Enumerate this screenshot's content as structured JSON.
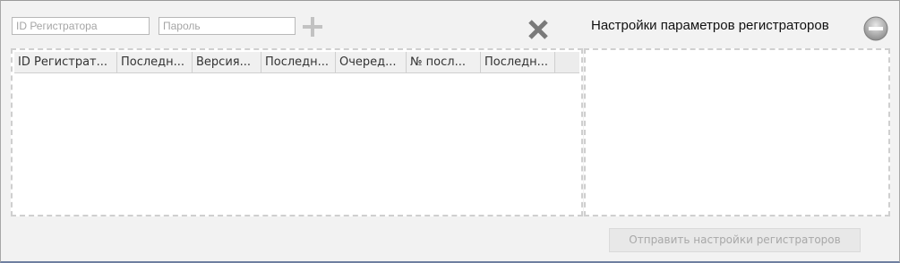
{
  "filters": {
    "id_placeholder": "ID Регистратора",
    "password_placeholder": "Пароль"
  },
  "icons": {
    "add": "plus-icon",
    "remove": "close-icon",
    "collapse": "minus-circle-icon"
  },
  "settings": {
    "title": "Настройки параметров регистраторов"
  },
  "table": {
    "columns": [
      "ID Регистрат...",
      "Последн...",
      "Версия...",
      "Последн...",
      "Очеред...",
      "№ посл...",
      "Последн..."
    ],
    "rows": []
  },
  "actions": {
    "send_label": "Отправить настройки регистраторов"
  },
  "colors": {
    "background": "#f2f2f2",
    "panel": "#ffffff",
    "disabled_text": "#a8a8a8"
  }
}
